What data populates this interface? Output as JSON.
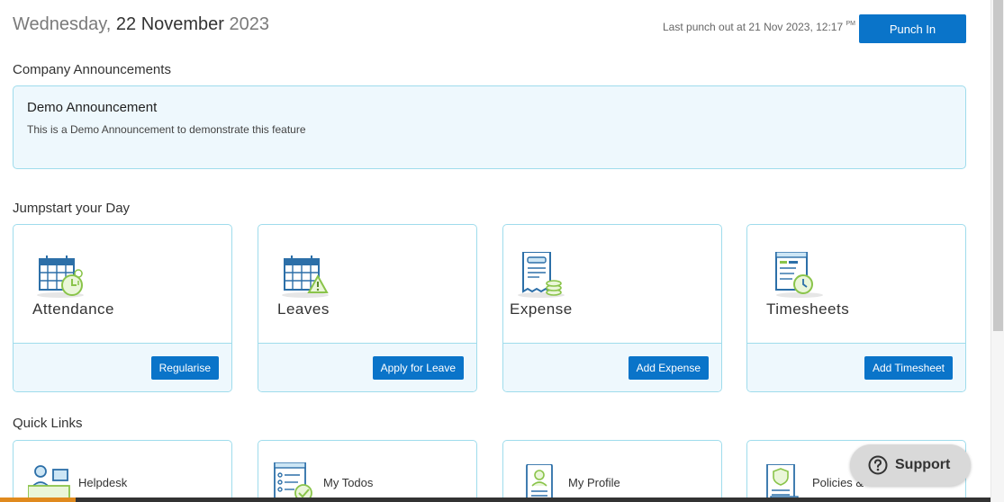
{
  "header": {
    "date_weekday": "Wednesday,",
    "date_main": "22 November",
    "date_year": "2023",
    "punch_status": "Last punch out at 21 Nov 2023, 12:17",
    "punch_status_suffix": "PM",
    "punch_button": "Punch In"
  },
  "announcements": {
    "section_title": "Company Announcements",
    "items": [
      {
        "title": "Demo Announcement",
        "body": "This is a Demo Announcement to demonstrate this feature"
      }
    ]
  },
  "jumpstart": {
    "section_title": "Jumpstart your Day",
    "cards": [
      {
        "label": "Attendance",
        "action": "Regularise",
        "icon": "attendance-calendar-icon"
      },
      {
        "label": "Leaves",
        "action": "Apply for Leave",
        "icon": "leave-calendar-icon"
      },
      {
        "label": "Expense",
        "action": "Add Expense",
        "icon": "expense-receipt-icon"
      },
      {
        "label": "Timesheets",
        "action": "Add Timesheet",
        "icon": "timesheet-clock-icon"
      }
    ]
  },
  "quick_links": {
    "section_title": "Quick Links",
    "items": [
      {
        "label": "Helpdesk",
        "icon": "helpdesk-agent-icon"
      },
      {
        "label": "My Todos",
        "icon": "todo-list-icon"
      },
      {
        "label": "My Profile",
        "icon": "profile-card-icon"
      },
      {
        "label": "Policies &",
        "icon": "policy-document-icon"
      }
    ]
  },
  "support": {
    "label": "Support",
    "icon": "question-circle-icon"
  },
  "colors": {
    "primary": "#0a74c9",
    "card_border": "#9fdcec",
    "card_tint": "#eef8fd",
    "icon_green": "#8ac44a"
  }
}
